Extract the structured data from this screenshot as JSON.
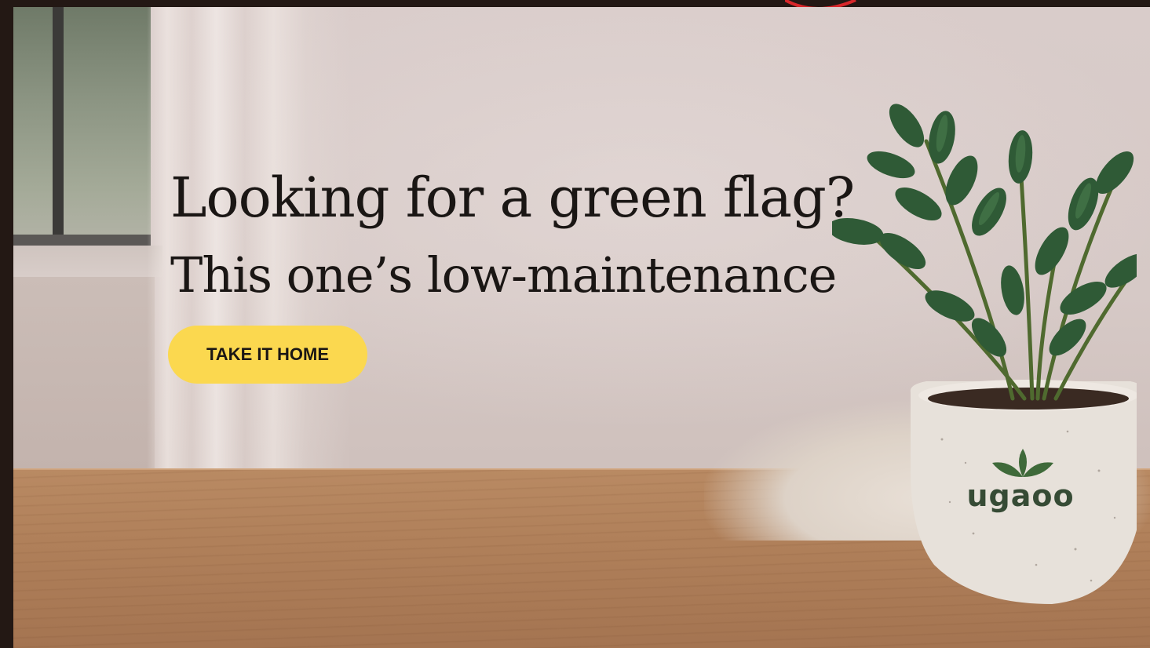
{
  "hero": {
    "headline": "Looking for a green flag?",
    "subheadline": "This one’s low-maintenance",
    "cta_label": "TAKE IT HOME"
  },
  "pot": {
    "brand_label": "ugaoo"
  },
  "colors": {
    "cta_background": "#fbd84f",
    "text": "#1a1614",
    "frame": "#231814",
    "brand_green": "#364b35"
  },
  "icons": {
    "pot_logo": "leaf-icon"
  }
}
